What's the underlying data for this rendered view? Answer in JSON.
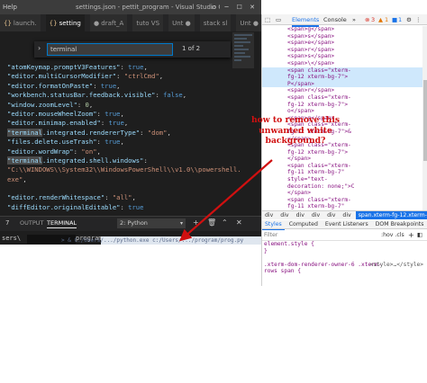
{
  "vscode": {
    "menu_label": "Help",
    "window_title": "settings.json - pettit_program - Visual Studio Code",
    "window_buttons": [
      "▫",
      "─",
      "☐",
      "✕"
    ],
    "tabs": [
      {
        "label": "launch."
      },
      {
        "label": "setting"
      },
      {
        "label": "● draft_A"
      },
      {
        "label": "tuto VS"
      },
      {
        "label": "Unt ●"
      },
      {
        "label": "stack sl"
      },
      {
        "label": "Unt ●"
      }
    ],
    "find": {
      "value": "terminal",
      "count": "1 of 2"
    },
    "code_lines": [
      {
        "key": "\"atomKeymap.promptV3Features\"",
        "sep": ": ",
        "val": "true",
        "vtype": "b",
        "end": ","
      },
      {
        "key": "\"editor.multiCursorModifier\"",
        "sep": ": ",
        "val": "\"ctrlCmd\"",
        "vtype": "s",
        "end": ","
      },
      {
        "key": "\"editor.formatOnPaste\"",
        "sep": ": ",
        "val": "true",
        "vtype": "b",
        "end": ","
      },
      {
        "key": "\"workbench.statusBar.feedback.visible\"",
        "sep": ": ",
        "val": "false",
        "vtype": "b",
        "end": ","
      },
      {
        "key": "\"window.zoomLevel\"",
        "sep": ": ",
        "val": "0",
        "vtype": "n",
        "end": ","
      },
      {
        "key": "\"editor.mouseWheelZoom\"",
        "sep": ": ",
        "val": "true",
        "vtype": "b",
        "end": ","
      },
      {
        "key": "\"editor.minimap.enabled\"",
        "sep": ": ",
        "val": "true",
        "vtype": "b",
        "end": ","
      },
      {
        "hl": "\"terminal",
        "key": ".integrated.rendererType\"",
        "sep": ": ",
        "val": "\"dom\"",
        "vtype": "s",
        "end": ","
      },
      {
        "key": "\"files.delete.useTrash\"",
        "sep": ": ",
        "val": "true",
        "vtype": "b",
        "end": ","
      },
      {
        "key": "\"editor.wordWrap\"",
        "sep": ": ",
        "val": "\"on\"",
        "vtype": "s",
        "end": ","
      },
      {
        "hl": "\"terminal",
        "key": ".integrated.shell.windows\"",
        "sep": ":",
        "val": "",
        "vtype": "s",
        "end": ""
      },
      {
        "key": "",
        "sep": "",
        "val": "\"C:\\\\WINDOWS\\\\System32\\\\WindowsPowerShell\\\\v1.0\\\\powershell.",
        "vtype": "s",
        "end": ""
      },
      {
        "key": "",
        "sep": "",
        "val": "exe\"",
        "vtype": "s",
        "end": ","
      },
      {
        "key": "",
        "sep": "",
        "val": "",
        "vtype": "s",
        "end": ""
      },
      {
        "key": "\"editor.renderWhitespace\"",
        "sep": ": ",
        "val": "\"all\"",
        "vtype": "s",
        "end": ","
      },
      {
        "key": "\"diffEditor.originalEditable\"",
        "sep": ": ",
        "val": "true",
        "vtype": "b",
        "end": ""
      }
    ],
    "panel": {
      "number": "7",
      "tab_output": "OUTPUT",
      "tab_terminal": "TERMINAL",
      "terminal_select": "2: Python",
      "terminal_prefix": "sers\\",
      "terminal_suffix": "program",
      "whitebg_text": "> & C:/Users/.../python.exe c:/Users/.../program/prog.py"
    }
  },
  "devtools": {
    "tabs": {
      "elements": "Elements",
      "console": "Console",
      "errors": "3",
      "warnings": "1",
      "info": "1",
      "more": "»"
    },
    "dom_lines": [
      {
        "t": "<span>g</span>",
        "cls": ""
      },
      {
        "t": "<span>s</span>",
        "cls": ""
      },
      {
        "t": "<span>e</span>",
        "cls": ""
      },
      {
        "t": "<span>r</span>",
        "cls": ""
      },
      {
        "t": "<span>s</span>",
        "cls": ""
      },
      {
        "t": "<span>\\</span>",
        "cls": ""
      },
      {
        "t": "<span class=\"xterm-",
        "cls": "sel"
      },
      {
        "t": "fg-12 xterm-bg-7\">",
        "cls": "sel"
      },
      {
        "t": "P</span>",
        "cls": "sel"
      },
      {
        "t": "<span>r</span>",
        "cls": ""
      },
      {
        "t": "<span class=\"xterm-",
        "cls": ""
      },
      {
        "t": "fg-12 xterm-bg-7\">",
        "cls": ""
      },
      {
        "t": "o</span>",
        "cls": ""
      },
      {
        "t": "<span>g</span>",
        "cls": ""
      },
      {
        "t": "<span class=\"xterm-",
        "cls": ""
      },
      {
        "t": "fg-12 xterm-bg-7\">&",
        "cls": ""
      },
      {
        "t": "</span>",
        "cls": ""
      },
      {
        "t": "<span class=\"xterm-",
        "cls": ""
      },
      {
        "t": "fg-12 xterm-bg-7\">",
        "cls": ""
      },
      {
        "t": "</span>",
        "cls": ""
      },
      {
        "t": "<span class=\"xterm-",
        "cls": ""
      },
      {
        "t": "fg-11 xterm-bg-7\"",
        "cls": ""
      },
      {
        "t": "style=\"text-",
        "cls": ""
      },
      {
        "t": "decoration: none;\">C",
        "cls": ""
      },
      {
        "t": "</span>",
        "cls": ""
      },
      {
        "t": "<span class=\"xterm-",
        "cls": ""
      },
      {
        "t": "fg-11 xterm-bg-7\"",
        "cls": ""
      },
      {
        "t": "style=\"text-",
        "cls": ""
      },
      {
        "t": "decoration: none;\">:",
        "cls": ""
      }
    ],
    "breadcrumbs": [
      "div",
      "div",
      "div",
      "div",
      "div",
      "div",
      "span.xterm-fg-12.xterm-bg-7"
    ],
    "style_tabs": [
      "Styles",
      "Computed",
      "Event Listeners",
      "DOM Breakpoints",
      "»"
    ],
    "filter_placeholder": "Filter",
    "hov_label": ":hov  .cls",
    "plus_label": "+",
    "styles_lines": [
      {
        "text": "element.style {",
        "src": ""
      },
      {
        "text": "}",
        "src": ""
      },
      {
        "text": "",
        "src": ""
      },
      {
        "text": ".xterm-dom-renderer-owner-6 .xterm-",
        "src": "<style>…</style>"
      },
      {
        "text": "rows span {",
        "src": ""
      }
    ]
  },
  "annotation": {
    "text": "how to remove this unwanted white background?",
    "color": "#d01010"
  },
  "colors": {
    "editor_bg": "#1e1e1e",
    "accent": "#007acc",
    "devtools_accent": "#1a73e8"
  }
}
